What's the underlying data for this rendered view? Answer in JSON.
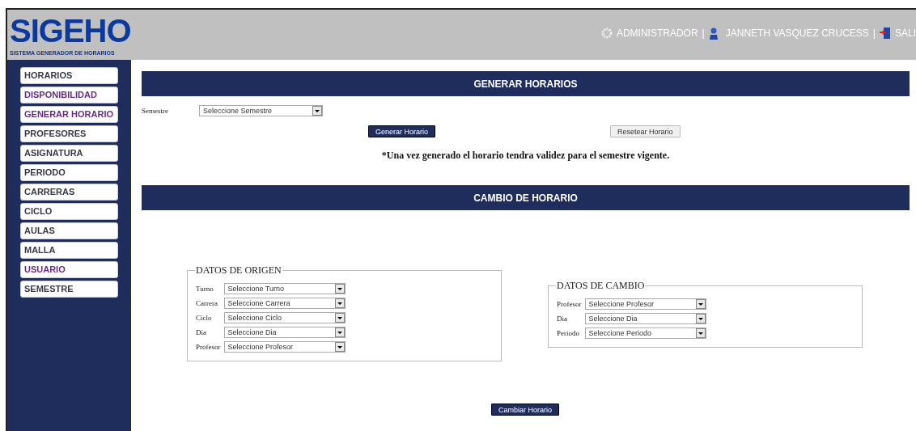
{
  "header": {
    "logo": "SIGEHO",
    "subtitle": "SISTEMA GENERADOR DE HORARIOS",
    "role": "ADMINISTRADOR",
    "separator_1": "|",
    "user": "JANNETH VASQUEZ CRUCESS",
    "separator_2": "|",
    "logout": "SALI"
  },
  "sidebar": {
    "items": [
      {
        "label": "HORARIOS",
        "visited": false
      },
      {
        "label": "DISPONIBILIDAD",
        "visited": true
      },
      {
        "label": "GENERAR HORARIO",
        "visited": true
      },
      {
        "label": "PROFESORES",
        "visited": false
      },
      {
        "label": "ASIGNATURA",
        "visited": false
      },
      {
        "label": "PERIODO",
        "visited": false
      },
      {
        "label": "CARRERAS",
        "visited": false
      },
      {
        "label": "CICLO",
        "visited": false
      },
      {
        "label": "AULAS",
        "visited": false
      },
      {
        "label": "MALLA",
        "visited": false
      },
      {
        "label": "USUARIO",
        "visited": true
      },
      {
        "label": "SEMESTRE",
        "visited": false
      }
    ]
  },
  "generar": {
    "title": "GENERAR HORARIOS",
    "semestre_label": "Semestre",
    "semestre_value": "Seleccione Semestre",
    "buttons": [
      {
        "label": "Generar Horario",
        "kind": "primary"
      },
      {
        "label": "Resetear Horario",
        "kind": "secondary"
      }
    ],
    "note": "*Una vez generado el horario tendra validez para el semestre vigente."
  },
  "cambio": {
    "title": "CAMBIO DE HORARIO",
    "origen": {
      "legend": "DATOS DE ORIGEN",
      "fields": [
        {
          "label": "Turno",
          "value": "Seleccione Turno"
        },
        {
          "label": "Carrera",
          "value": "Seleccione Carrera"
        },
        {
          "label": "Ciclo",
          "value": "Seleccione Ciclo"
        },
        {
          "label": "Dia",
          "value": "Seleccione Dia"
        },
        {
          "label": "Profesor",
          "value": "Seleccione Profesor"
        }
      ]
    },
    "destino": {
      "legend": "DATOS DE CAMBIO",
      "fields": [
        {
          "label": "Profesor",
          "value": "Seleccione Profesor"
        },
        {
          "label": "Dia",
          "value": "Seleccione Dia"
        },
        {
          "label": "Periodo",
          "value": "Seleccione Periodo"
        }
      ]
    },
    "button": "Cambiar Horario"
  }
}
